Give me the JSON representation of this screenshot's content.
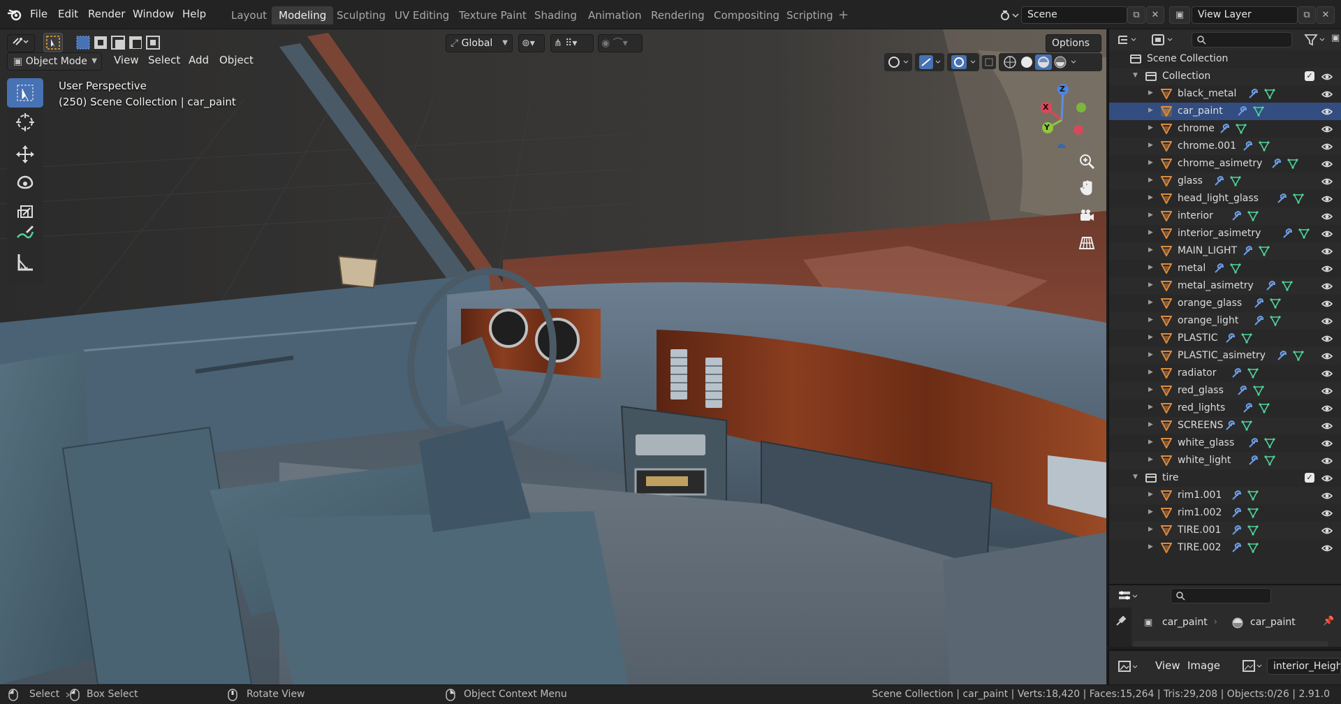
{
  "app": {
    "menus": [
      "File",
      "Edit",
      "Render",
      "Window",
      "Help"
    ],
    "workspaces": [
      "Layout",
      "Modeling",
      "Sculpting",
      "UV Editing",
      "Texture Paint",
      "Shading",
      "Animation",
      "Rendering",
      "Compositing",
      "Scripting"
    ],
    "active_workspace": "Modeling",
    "add_workspace": "+",
    "scene_name": "Scene",
    "view_layer": "View Layer"
  },
  "viewport": {
    "mode": "Object Mode",
    "menus": [
      "View",
      "Select",
      "Add",
      "Object"
    ],
    "orientation": "Global",
    "options_label": "Options",
    "overlay_title": "User Perspective",
    "overlay_subtitle": "(250) Scene Collection | car_paint",
    "gizmo_axes": {
      "x": "X",
      "y": "Y",
      "z": "Z"
    },
    "tools": [
      "select-box-icon",
      "cursor-icon",
      "move-icon",
      "rotate-icon",
      "scale-icon",
      "transform-icon",
      "annotate-icon",
      "measure-icon"
    ]
  },
  "outliner": {
    "root": "Scene Collection",
    "collections": [
      {
        "name": "Collection",
        "items": [
          "black_metal",
          "car_paint",
          "chrome",
          "chrome.001",
          "chrome_asimetry",
          "glass",
          "head_light_glass",
          "interior",
          "interior_asimetry",
          "MAIN_LIGHT",
          "metal",
          "metal_asimetry",
          "orange_glass",
          "orange_light",
          "PLASTIC",
          "PLASTIC_asimetry",
          "radiator",
          "red_glass",
          "red_lights",
          "SCREENS",
          "white_glass",
          "white_light"
        ]
      },
      {
        "name": "tire",
        "items": [
          "rim1.001",
          "rim1.002",
          "TIRE.001",
          "TIRE.002"
        ]
      }
    ],
    "selected": "car_paint"
  },
  "properties": {
    "object_name": "car_paint",
    "material_name": "car_paint"
  },
  "image_editor": {
    "menus": [
      "View",
      "Image"
    ],
    "image_name": "interior_Height.p"
  },
  "statusbar": {
    "select": "Select",
    "box_select": "Box Select",
    "rotate_view": "Rotate View",
    "context_menu": "Object Context Menu",
    "stats": "Scene Collection | car_paint | Verts:18,420 | Faces:15,264 | Tris:29,208 | Objects:0/26 | 2.91.0"
  },
  "colors": {
    "accent": "#4772b3",
    "mesh_icon": "#e08a3c",
    "modifier_icon": "#6d9ee8",
    "data_icon": "#4fd39a"
  }
}
